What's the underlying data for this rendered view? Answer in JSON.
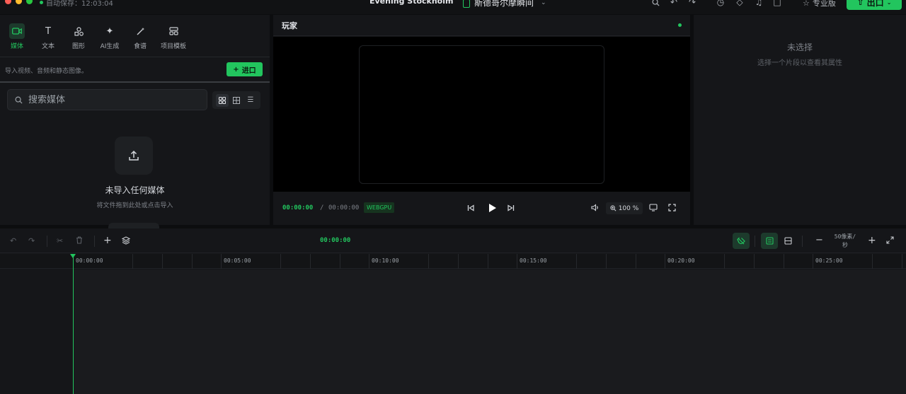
{
  "titlebar": {
    "autosave": "自动保存：12:03:04",
    "app_title": "Evening Stockholm",
    "project_name": "斯德哥尔摩瞬间",
    "pro_label": "专业版",
    "export_label": "出口"
  },
  "left_panel": {
    "tabs": [
      {
        "label": "媒体",
        "icon": "video-icon"
      },
      {
        "label": "文本",
        "icon": "text-icon"
      },
      {
        "label": "图形",
        "icon": "shapes-icon"
      },
      {
        "label": "AI生成",
        "icon": "sparkle-icon"
      },
      {
        "label": "食谱",
        "icon": "magic-wand-icon"
      },
      {
        "label": "项目模板",
        "icon": "template-icon"
      }
    ],
    "import_hint": "导入视频、音频和静态图像。",
    "import_button": "进口",
    "search_placeholder": "搜索媒体",
    "empty_title": "未导入任何媒体",
    "empty_subtitle": "将文件拖到此处或点击导入"
  },
  "preview": {
    "title": "玩家",
    "current_time": "00:00:00",
    "separator": "/",
    "total_time": "00:00:00",
    "renderer_badge": "WEBGPU",
    "zoom": "100 %"
  },
  "inspector": {
    "title": "未选择",
    "subtitle": "选择一个片段以查看其属性"
  },
  "timeline": {
    "current_time": "00:00:00",
    "zoom_label_line1": "50像素/",
    "zoom_label_line2": "秒",
    "ruler_labels": [
      "00:00:00",
      "00:05:00",
      "00:10:00",
      "00:15:00",
      "00:20:00",
      "00:25:00"
    ]
  },
  "colors": {
    "accent": "#22c55e",
    "background": "#0c0d0f",
    "panel": "#151619"
  }
}
